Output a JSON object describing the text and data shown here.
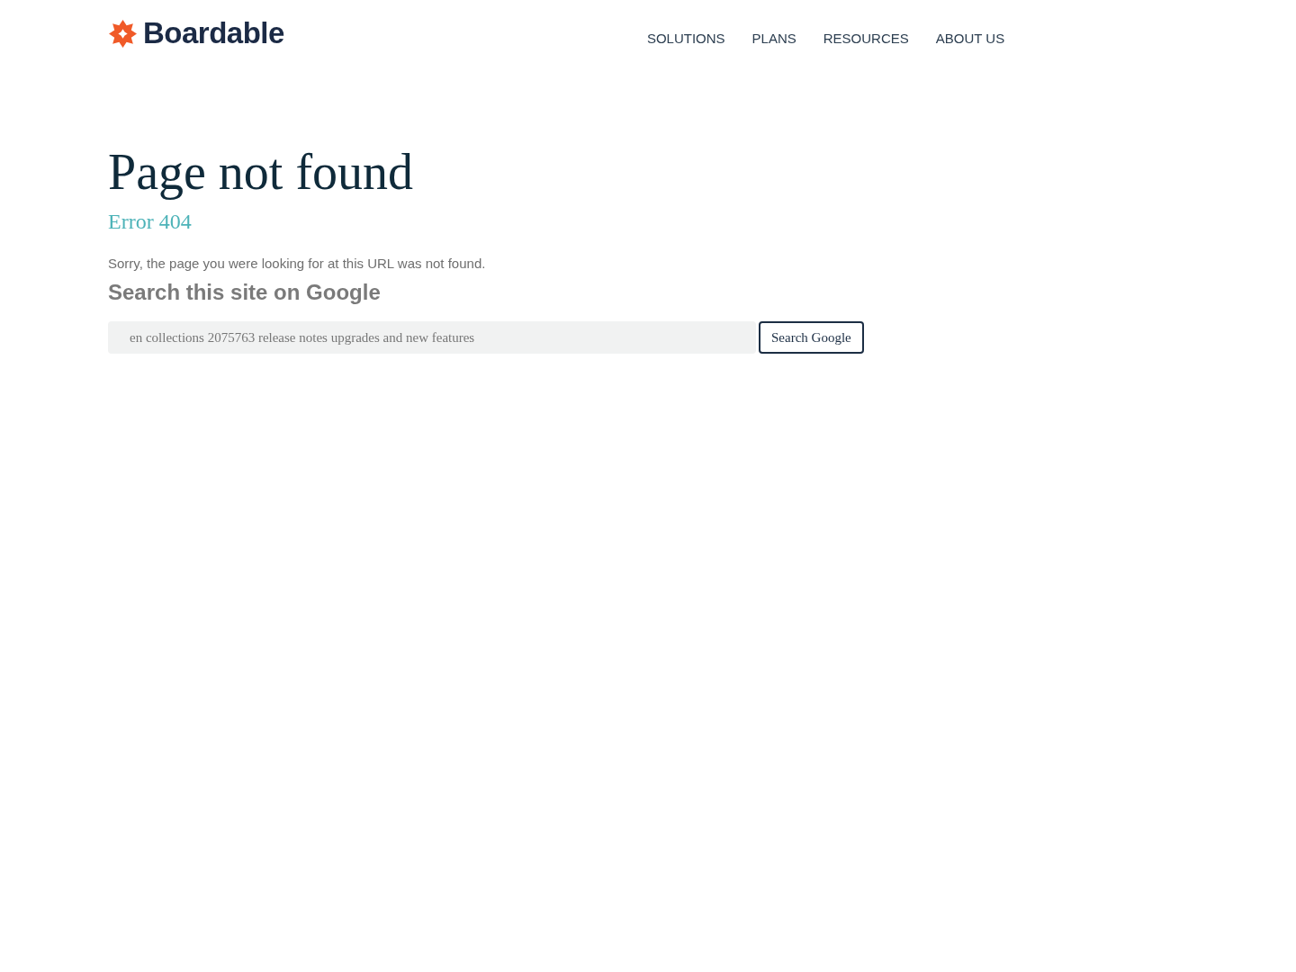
{
  "header": {
    "logo_text": "Boardable",
    "nav": [
      {
        "label": "SOLUTIONS"
      },
      {
        "label": "PLANS"
      },
      {
        "label": "RESOURCES"
      },
      {
        "label": "ABOUT US"
      }
    ]
  },
  "title": "Page not found",
  "subtitle": "Error 404",
  "message": "Sorry, the page you were looking for at this URL was not found.",
  "search": {
    "heading": "Search this site on Google",
    "value": "en collections 2075763 release notes upgrades and new features",
    "button": "Search Google"
  }
}
